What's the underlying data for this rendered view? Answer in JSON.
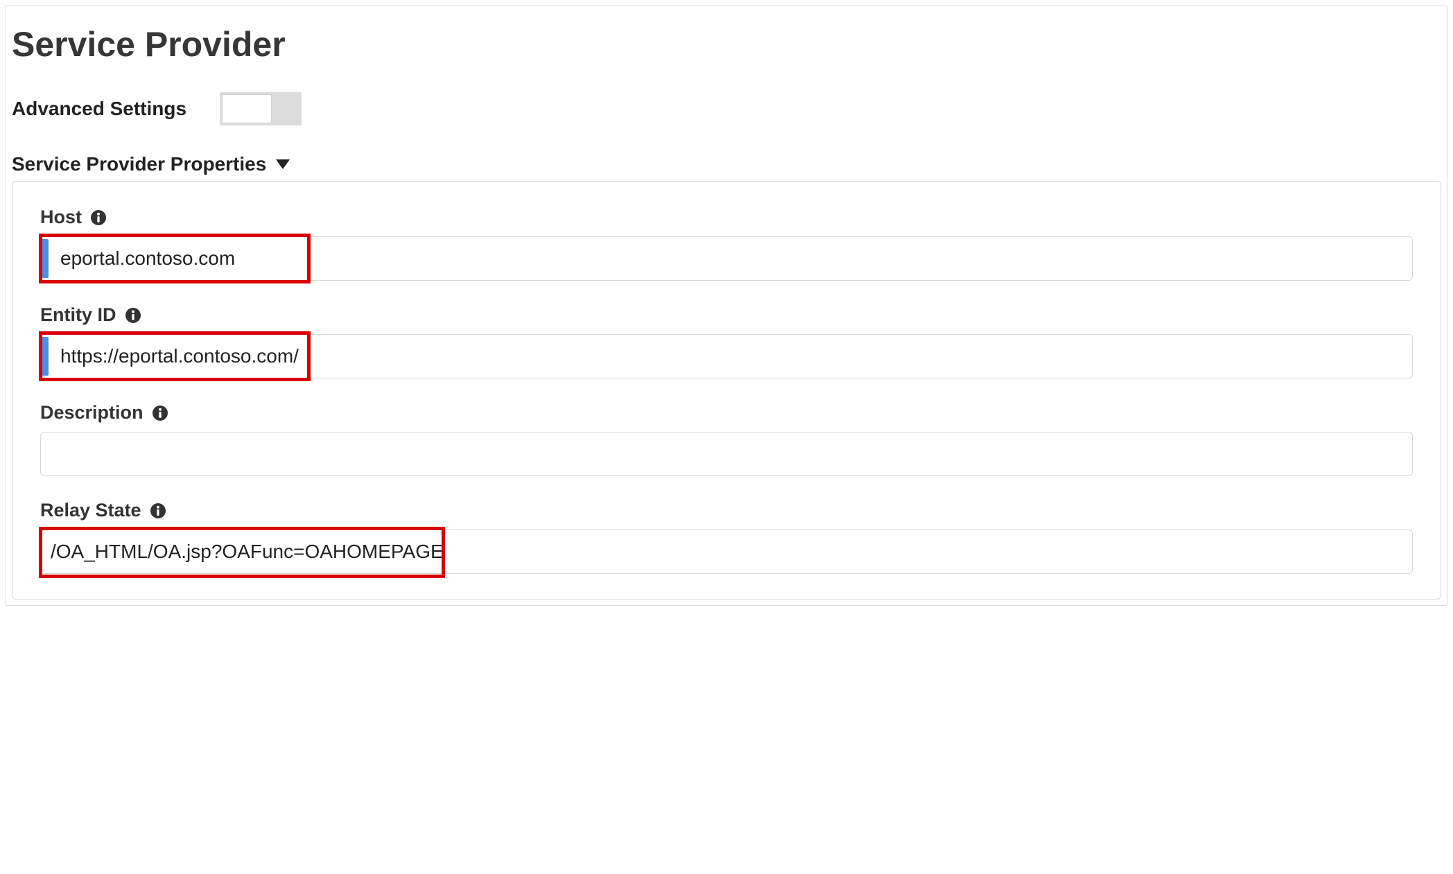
{
  "page": {
    "title": "Service Provider"
  },
  "advanced": {
    "label": "Advanced Settings",
    "on": false
  },
  "section": {
    "title": "Service Provider Properties"
  },
  "fields": {
    "host": {
      "label": "Host",
      "value": "eportal.contoso.com"
    },
    "entity_id": {
      "label": "Entity ID",
      "value": "https://eportal.contoso.com/"
    },
    "description": {
      "label": "Description",
      "value": ""
    },
    "relay_state": {
      "label": "Relay State",
      "value": "/OA_HTML/OA.jsp?OAFunc=OAHOMEPAGE"
    }
  },
  "colors": {
    "highlight": "#d80000",
    "focus_bar": "#4a8ee6"
  }
}
